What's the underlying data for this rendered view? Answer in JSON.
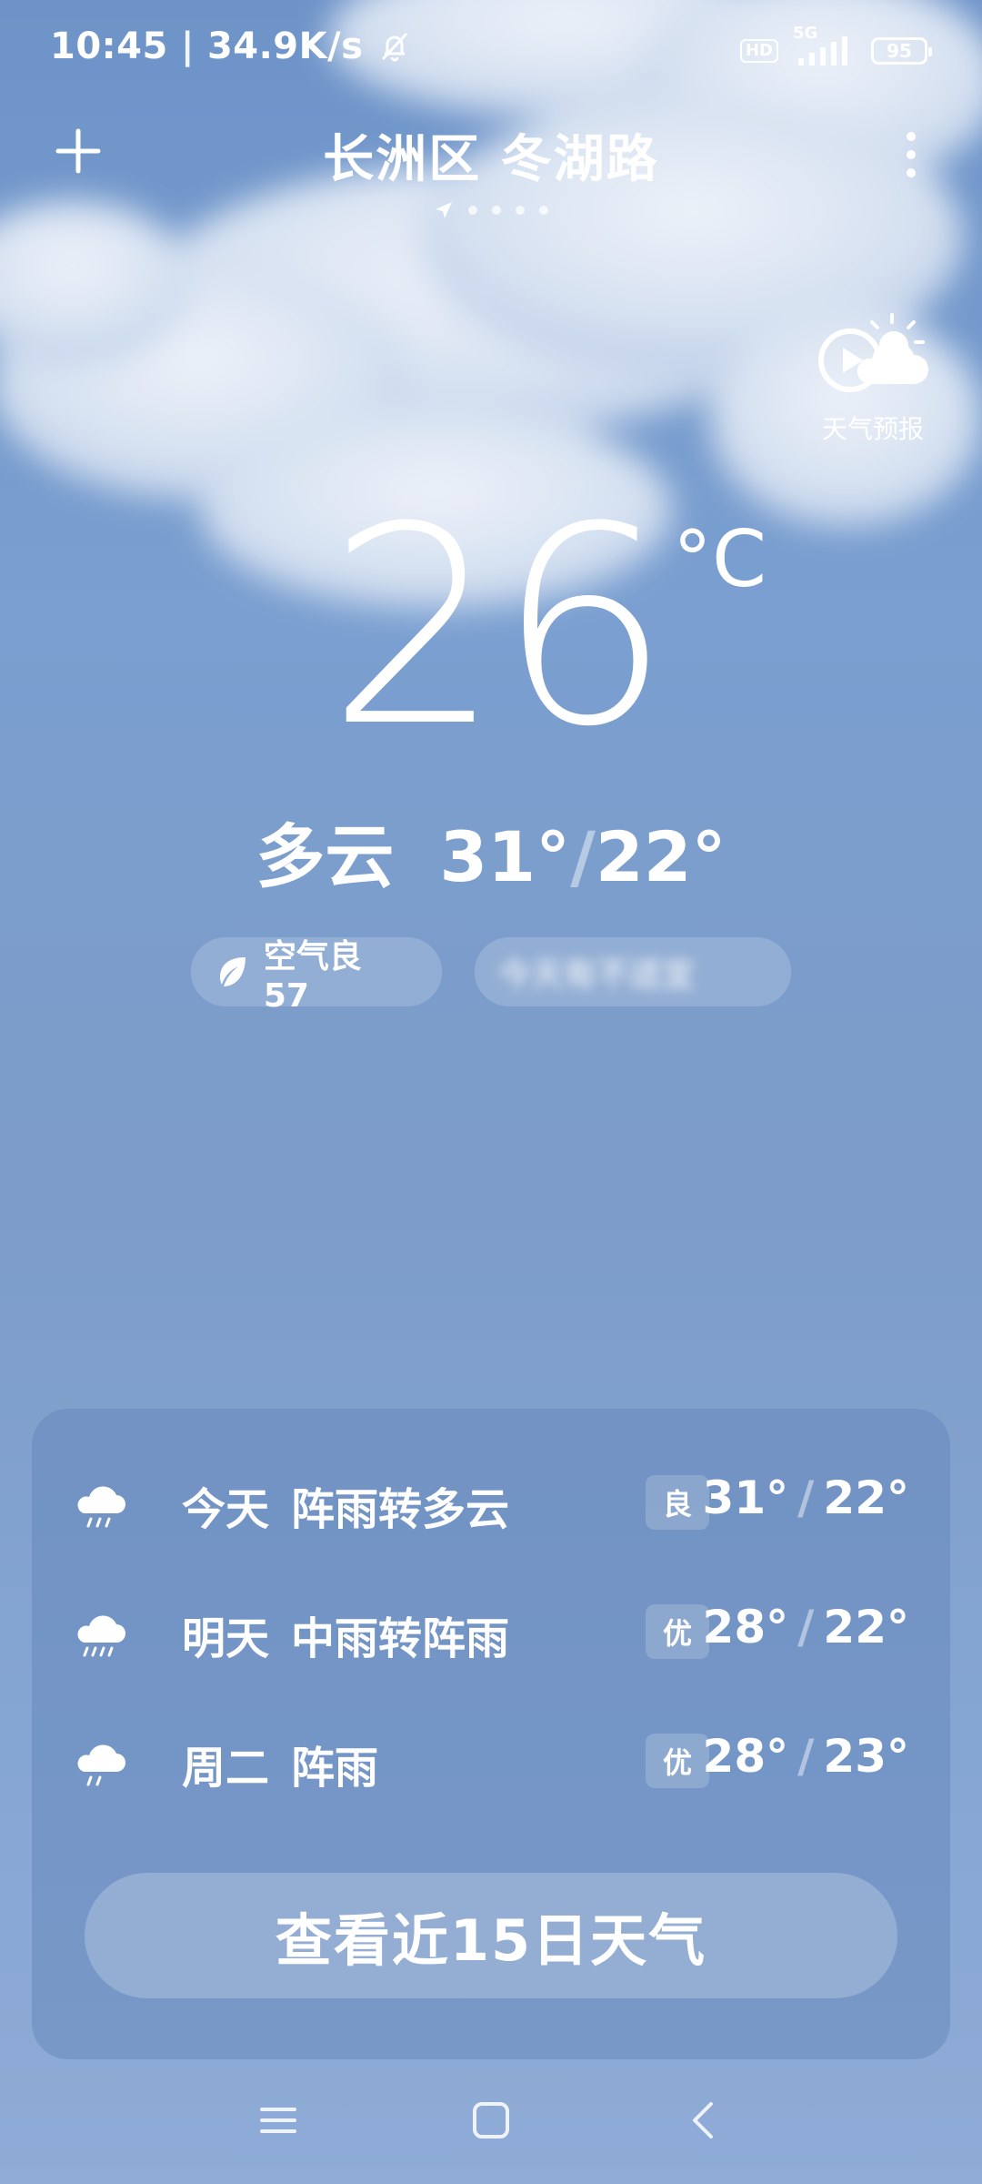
{
  "status_bar": {
    "time": "10:45",
    "speed": "34.9K/s",
    "hd": "HD",
    "network": "5G",
    "battery": "95"
  },
  "header": {
    "location": "长洲区 冬湖路",
    "page_count": 5,
    "active_page": 1
  },
  "forecast_video": {
    "label": "天气预报"
  },
  "current": {
    "temperature": "26",
    "unit": "°C",
    "condition": "多云",
    "high": "31°",
    "low": "22°",
    "aqi_label": "空气良 57",
    "blurred_chip": "今天有不适宜"
  },
  "daily": [
    {
      "day": "今天",
      "condition": "阵雨转多云",
      "aqi": "良",
      "high": "31°",
      "low": "22°",
      "icon": "rain-cloud-icon"
    },
    {
      "day": "明天",
      "condition": "中雨转阵雨",
      "aqi": "优",
      "high": "28°",
      "low": "22°",
      "icon": "rain-cloud-icon"
    },
    {
      "day": "周二",
      "condition": "阵雨",
      "aqi": "优",
      "high": "28°",
      "low": "23°",
      "icon": "rain-cloud-icon"
    }
  ],
  "view_15_days": "查看近15日天气",
  "colors": {
    "sky_top": "#6d93c8",
    "sky_bottom": "#8fabd6",
    "text": "#ffffff"
  }
}
